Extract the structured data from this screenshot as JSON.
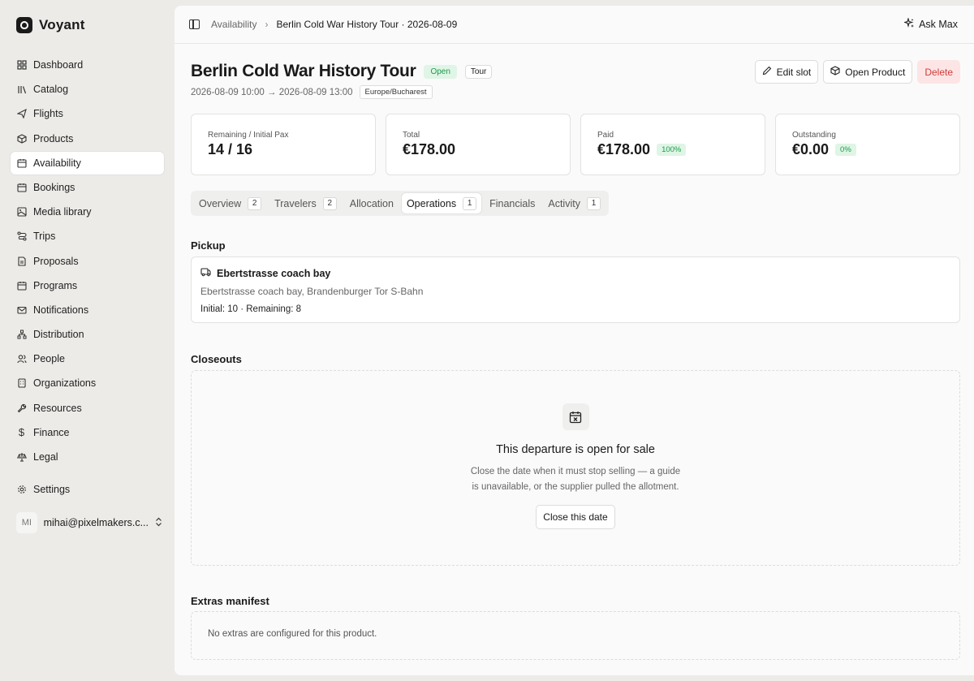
{
  "app": {
    "name": "Voyant"
  },
  "sidebar": {
    "items": [
      {
        "label": "Dashboard",
        "icon": "dashboard-icon"
      },
      {
        "label": "Catalog",
        "icon": "catalog-icon"
      },
      {
        "label": "Flights",
        "icon": "plane-icon"
      },
      {
        "label": "Products",
        "icon": "box-icon"
      },
      {
        "label": "Availability",
        "icon": "calendar-icon",
        "active": true
      },
      {
        "label": "Bookings",
        "icon": "calendar-icon"
      },
      {
        "label": "Media library",
        "icon": "image-icon"
      },
      {
        "label": "Trips",
        "icon": "route-icon"
      },
      {
        "label": "Proposals",
        "icon": "document-icon"
      },
      {
        "label": "Programs",
        "icon": "calendar-icon"
      },
      {
        "label": "Notifications",
        "icon": "mail-icon"
      },
      {
        "label": "Distribution",
        "icon": "network-icon"
      },
      {
        "label": "People",
        "icon": "people-icon"
      },
      {
        "label": "Organizations",
        "icon": "building-icon"
      },
      {
        "label": "Resources",
        "icon": "wrench-icon"
      },
      {
        "label": "Finance",
        "icon": "dollar-icon"
      },
      {
        "label": "Legal",
        "icon": "scale-icon"
      }
    ],
    "settings_label": "Settings",
    "user": {
      "initials": "MI",
      "email": "mihai@pixelmakers.c..."
    }
  },
  "topbar": {
    "breadcrumb_parent": "Availability",
    "breadcrumb_current": "Berlin Cold War History Tour · 2026-08-09",
    "ask_label": "Ask Max"
  },
  "header": {
    "title": "Berlin Cold War History Tour",
    "status_badge": "Open",
    "type_badge": "Tour",
    "time_range": "2026-08-09 10:00 → 2026-08-09 13:00",
    "timezone": "Europe/Bucharest",
    "edit_label": "Edit slot",
    "open_product_label": "Open Product",
    "delete_label": "Delete"
  },
  "stats": [
    {
      "label": "Remaining / Initial Pax",
      "value": "14 / 16",
      "badge": ""
    },
    {
      "label": "Total",
      "value": "€178.00",
      "badge": ""
    },
    {
      "label": "Paid",
      "value": "€178.00",
      "badge": "100%"
    },
    {
      "label": "Outstanding",
      "value": "€0.00",
      "badge": "0%"
    }
  ],
  "tabs": [
    {
      "label": "Overview",
      "count": "2"
    },
    {
      "label": "Travelers",
      "count": "2"
    },
    {
      "label": "Allocation",
      "count": ""
    },
    {
      "label": "Operations",
      "count": "1",
      "active": true
    },
    {
      "label": "Financials",
      "count": ""
    },
    {
      "label": "Activity",
      "count": "1"
    }
  ],
  "pickup": {
    "section_title": "Pickup",
    "name": "Ebertstrasse coach bay",
    "address": "Ebertstrasse coach bay, Brandenburger Tor S-Bahn",
    "counts": "Initial: 10 · Remaining: 8"
  },
  "closeouts": {
    "section_title": "Closeouts",
    "empty_title": "This departure is open for sale",
    "empty_desc": "Close the date when it must stop selling — a guide is unavailable, or the supplier pulled the allotment.",
    "button_label": "Close this date"
  },
  "extras": {
    "section_title": "Extras manifest",
    "empty_text": "No extras are configured for this product."
  },
  "colors": {
    "open_badge_bg": "#dff5e6",
    "open_badge_text": "#1e9a4a",
    "delete_bg": "#fde5e5",
    "delete_text": "#d23c3c"
  }
}
